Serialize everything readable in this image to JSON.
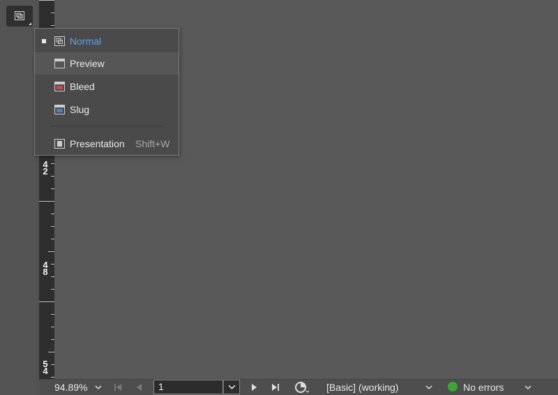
{
  "screen_mode_menu": {
    "items": [
      {
        "label": "Normal",
        "checked": true,
        "icon": "normal-view-icon"
      },
      {
        "label": "Preview",
        "icon": "preview-view-icon"
      },
      {
        "label": "Bleed",
        "icon": "bleed-view-icon"
      },
      {
        "label": "Slug",
        "icon": "slug-view-icon"
      },
      {
        "label": "Presentation",
        "shortcut": "Shift+W",
        "icon": "presentation-view-icon"
      }
    ]
  },
  "ruler": {
    "labels": [
      {
        "d1": "4",
        "d2": "2"
      },
      {
        "d1": "4",
        "d2": "8"
      },
      {
        "d1": "5",
        "d2": "4"
      }
    ]
  },
  "status_bar": {
    "zoom": "94.89%",
    "page_number": "1",
    "preflight_profile": "[Basic] (working)",
    "preflight_status": "No errors"
  },
  "colors": {
    "active_item": "#5aa2f0",
    "status_ok": "#3fa336",
    "bleed_icon": "#c0504d",
    "slug_icon": "#4f7fbf"
  }
}
